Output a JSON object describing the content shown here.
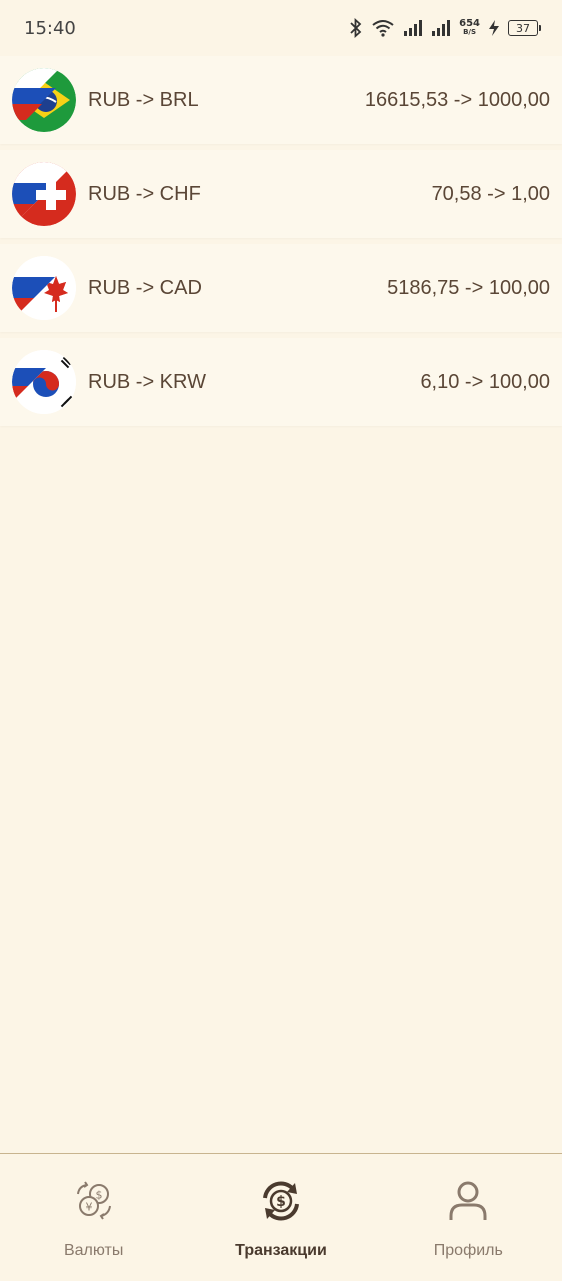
{
  "status_bar": {
    "time": "15:40",
    "net_speed": "654",
    "net_unit": "B/S",
    "battery": "37"
  },
  "transactions": [
    {
      "flag": "ru-br",
      "pair": "RUB -> BRL",
      "amount": "16615,53 -> 1000,00"
    },
    {
      "flag": "ru-ch",
      "pair": "RUB -> CHF",
      "amount": "70,58 -> 1,00"
    },
    {
      "flag": "ru-ca",
      "pair": "RUB -> CAD",
      "amount": "5186,75 -> 100,00"
    },
    {
      "flag": "ru-kr",
      "pair": "RUB -> KRW",
      "amount": "6,10 -> 100,00"
    }
  ],
  "bottom_nav": {
    "items": [
      {
        "label": "Валюты",
        "icon": "currencies-icon",
        "active": false
      },
      {
        "label": "Транзакции",
        "icon": "exchange-icon",
        "active": true
      },
      {
        "label": "Профиль",
        "icon": "profile-icon",
        "active": false
      }
    ]
  },
  "colors": {
    "background": "#fcf5e6",
    "row_background": "#fdf8ec",
    "text": "#5a4636",
    "nav_border": "#c8b48f",
    "nav_inactive": "#8a7a6c",
    "nav_active": "#4a3a2e"
  }
}
